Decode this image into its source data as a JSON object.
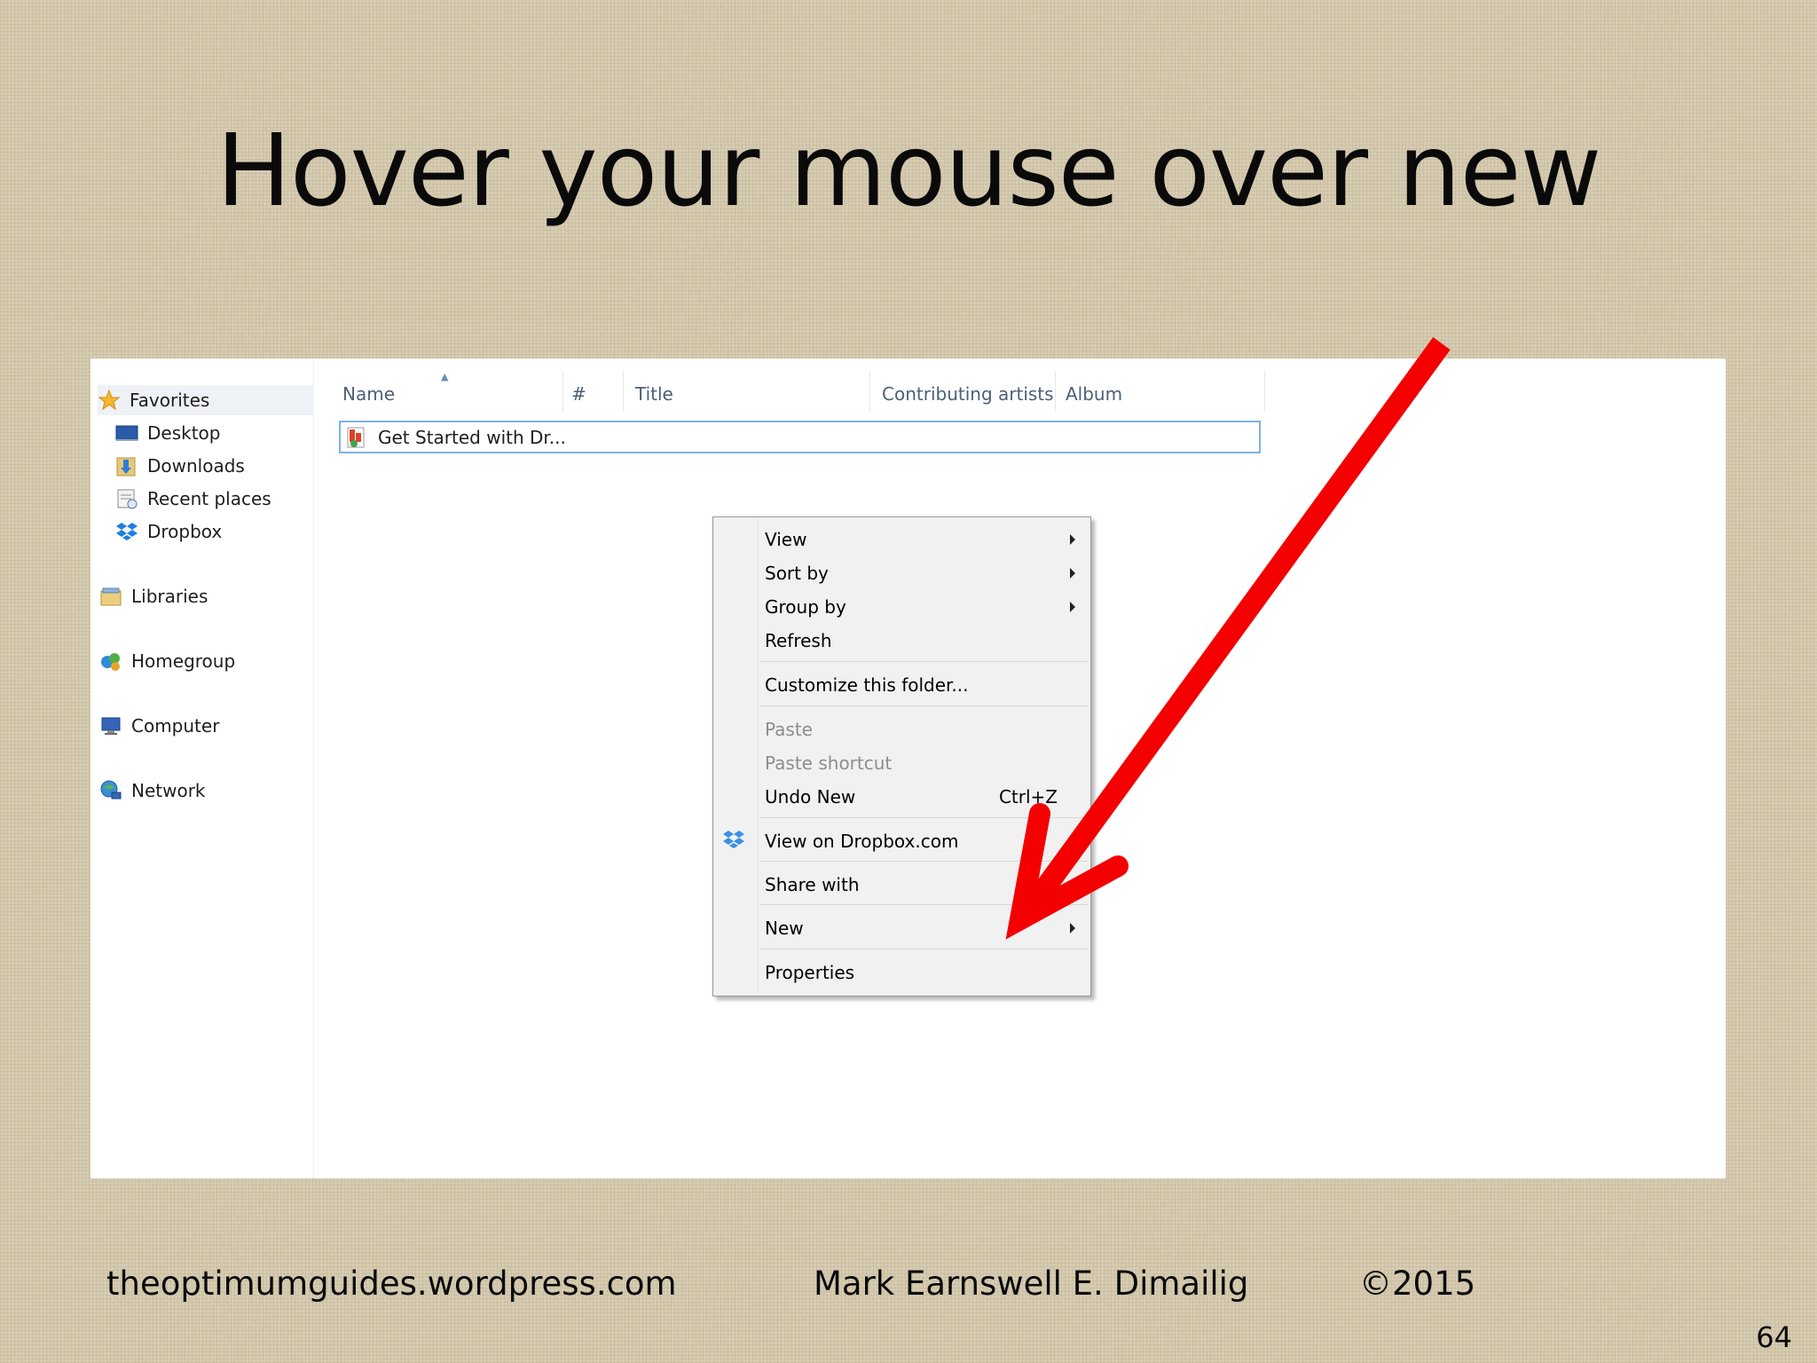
{
  "slide": {
    "title": "Hover your mouse over new",
    "footer_left": "theoptimumguides.wordpress.com",
    "footer_center": "Mark Earnswell E. Dimailig",
    "footer_right": "©2015",
    "page_number": "64"
  },
  "nav": {
    "favorites": "Favorites",
    "desktop": "Desktop",
    "downloads": "Downloads",
    "recent_places": "Recent places",
    "dropbox": "Dropbox",
    "libraries": "Libraries",
    "homegroup": "Homegroup",
    "computer": "Computer",
    "network": "Network"
  },
  "columns": [
    "Name",
    "#",
    "Title",
    "Contributing artists",
    "Album"
  ],
  "file": {
    "name": "Get Started with Dr..."
  },
  "context_menu": {
    "view": "View",
    "sort_by": "Sort by",
    "group_by": "Group by",
    "refresh": "Refresh",
    "customize": "Customize this folder...",
    "paste": "Paste",
    "paste_shortcut": "Paste shortcut",
    "undo_new": "Undo New",
    "undo_shortcut": "Ctrl+Z",
    "view_on_dropbox": "View on Dropbox.com",
    "share_with": "Share with",
    "new": "New",
    "properties": "Properties"
  },
  "colors": {
    "arrow": "#f40000",
    "selection_border": "#7fb2e6",
    "header_text": "#4c607a"
  },
  "icons": [
    "star-icon",
    "desktop-icon",
    "downloads-folder-icon",
    "recent-places-icon",
    "dropbox-icon",
    "libraries-icon",
    "homegroup-icon",
    "computer-icon",
    "network-icon",
    "pdf-file-icon",
    "submenu-arrow-icon",
    "red-arrow-icon"
  ]
}
